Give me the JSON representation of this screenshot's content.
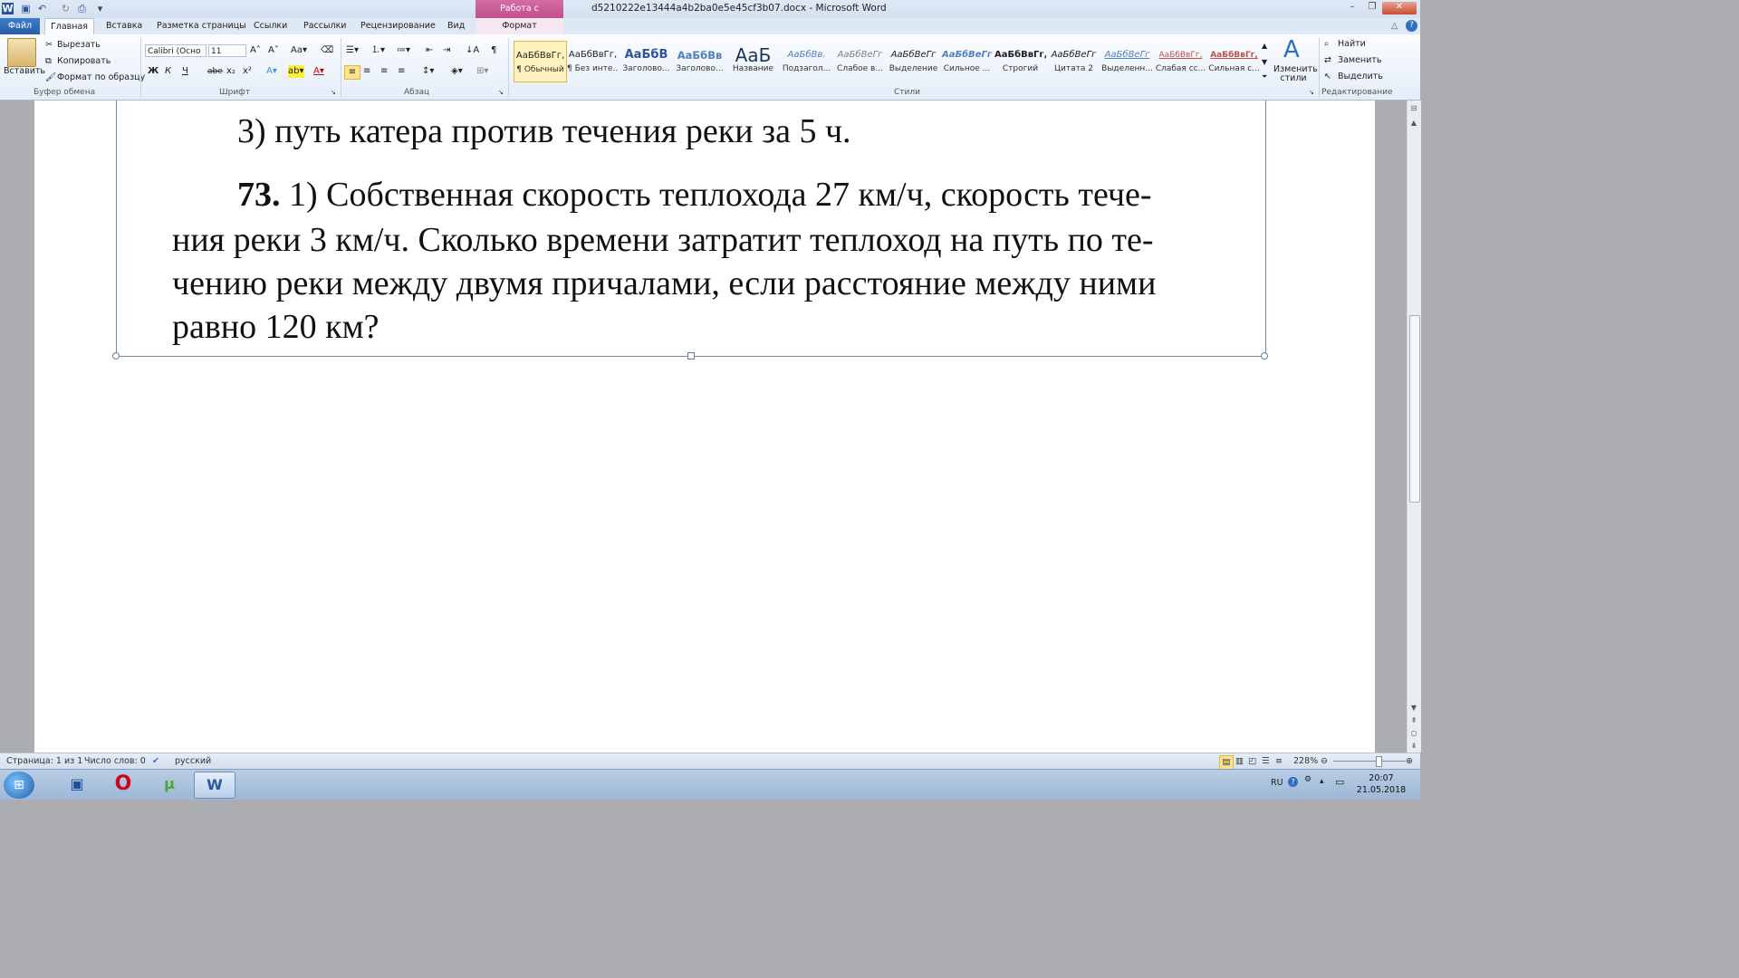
{
  "window": {
    "title": "d5210222e13444a4b2ba0e5e45cf3b07.docx - Microsoft Word",
    "context_tab": "Работа с рисунками"
  },
  "tabs": {
    "file": "Файл",
    "items": [
      "Главная",
      "Вставка",
      "Разметка страницы",
      "Ссылки",
      "Рассылки",
      "Рецензирование",
      "Вид"
    ],
    "format": "Формат"
  },
  "clipboard": {
    "paste": "Вставить",
    "cut": "Вырезать",
    "copy": "Копировать",
    "format_painter": "Формат по образцу",
    "group": "Буфер обмена"
  },
  "font": {
    "name": "Calibri (Осно",
    "size": "11",
    "bold": "Ж",
    "italic": "К",
    "underline": "Ч",
    "strike": "abe",
    "sub": "x₂",
    "sup": "x²",
    "group": "Шрифт"
  },
  "paragraph": {
    "group": "Абзац"
  },
  "styles": {
    "group": "Стили",
    "items": [
      {
        "sample": "АаБбВвГг,",
        "name": "¶ Обычный"
      },
      {
        "sample": "АаБбВвГг,",
        "name": "¶ Без инте..."
      },
      {
        "sample": "АаБбВ",
        "name": "Заголово..."
      },
      {
        "sample": "АаБбВв",
        "name": "Заголово..."
      },
      {
        "sample": "АаБ",
        "name": "Название"
      },
      {
        "sample": "АаБбВв.",
        "name": "Подзагол..."
      },
      {
        "sample": "АаБбВеГг",
        "name": "Слабое в..."
      },
      {
        "sample": "АаБбВеГг",
        "name": "Выделение"
      },
      {
        "sample": "АаБбВеГг",
        "name": "Сильное ..."
      },
      {
        "sample": "АаБбВвГг,",
        "name": "Строгий"
      },
      {
        "sample": "АаБбВеГг",
        "name": "Цитата 2"
      },
      {
        "sample": "АаБбВеГг",
        "name": "Выделенн..."
      },
      {
        "sample": "АаБбВвГг,",
        "name": "Слабая сс..."
      },
      {
        "sample": "АаБбВвГг,",
        "name": "Сильная с..."
      }
    ],
    "change": "Изменить стили"
  },
  "editing": {
    "find": "Найти",
    "replace": "Заменить",
    "select": "Выделить",
    "group": "Редактирование"
  },
  "document": {
    "line0": "3) путь катера против течения реки за 5 ч.",
    "problem_number": "73.",
    "line1_rest": " 1) Собственная скорость теплохода 27 км/ч, скорость тече-",
    "line2": "ния реки 3 км/ч. Сколько времени затратит теплоход на путь по те-",
    "line3": "чению реки между двумя причалами, если расстояние между ними",
    "line4": "равно 120 км?"
  },
  "status": {
    "page": "Страница: 1 из 1",
    "words": "Число слов: 0",
    "language": "русский",
    "zoom": "228%"
  },
  "taskbar": {
    "lang": "RU",
    "time": "20:07",
    "date": "21.05.2018"
  },
  "icons": [
    "word-icon",
    "save-icon",
    "undo-icon",
    "redo-icon",
    "print-preview-icon",
    "paste-icon",
    "scissors-icon",
    "copy-icon",
    "format-painter-icon",
    "search-icon",
    "windows-start-icon",
    "opera-icon",
    "utorrent-icon"
  ]
}
